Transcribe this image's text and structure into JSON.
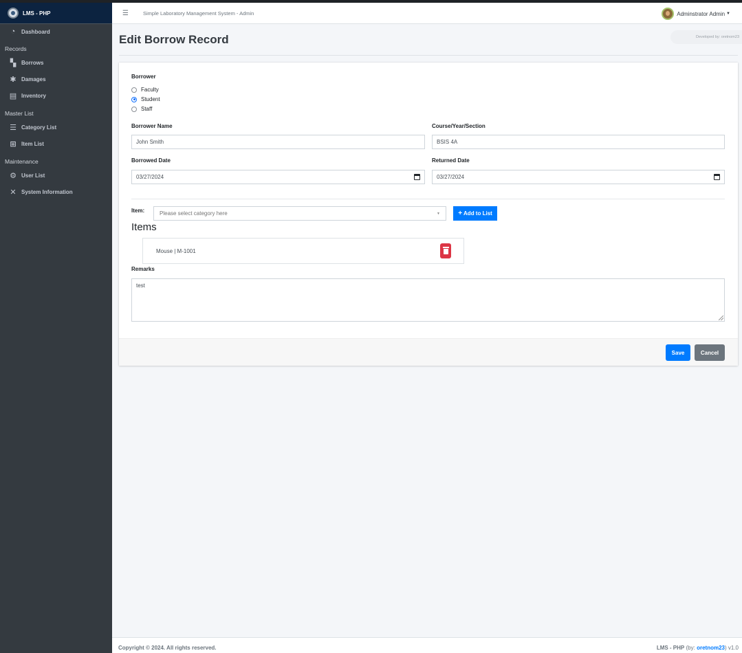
{
  "brand": {
    "name": "LMS - PHP"
  },
  "sidebar": {
    "dashboard": "Dashboard",
    "records_header": "Records",
    "borrows": "Borrows",
    "damages": "Damages",
    "inventory": "Inventory",
    "masterlist_header": "Master List",
    "category_list": "Category List",
    "item_list": "Item List",
    "maintenance_header": "Maintenance",
    "user_list": "User List",
    "system_information": "System Information"
  },
  "navbar": {
    "system_title": "Simple Laboratory Management System - Admin",
    "user_name": "Adminstrator Admin",
    "developed_by": "Developed by: oretnom23"
  },
  "page": {
    "title": "Edit Borrow Record"
  },
  "form": {
    "borrower_label": "Borrower",
    "borrower_options": [
      "Faculty",
      "Student",
      "Staff"
    ],
    "borrower_selected": "Student",
    "borrower_name_label": "Borrower Name",
    "borrower_name_value": "John Smith",
    "course_label": "Course/Year/Section",
    "course_value": "BSIS 4A",
    "borrowed_date_label": "Borrowed Date",
    "borrowed_date_value": "03/27/2024",
    "returned_date_label": "Returned Date",
    "returned_date_value": "03/27/2024",
    "item_label": "Item:",
    "item_placeholder": "Please select category here",
    "add_button": "Add to List",
    "items_heading": "Items",
    "items": [
      {
        "name": "Mouse | M-1001"
      }
    ],
    "remarks_label": "Remarks",
    "remarks_value": "test",
    "save_button": "Save",
    "cancel_button": "Cancel"
  },
  "footer": {
    "copyright": "Copyright © 2024. All rights reserved.",
    "app_name": "LMS - PHP",
    "by_prefix": "(by:",
    "author": "oretnom23",
    "version_suffix": ") v1.0"
  },
  "colors": {
    "primary": "#007bff",
    "danger": "#dc3545",
    "secondary": "#6c757d",
    "sidebar": "#343a40",
    "brand_bg": "#0c2340"
  }
}
